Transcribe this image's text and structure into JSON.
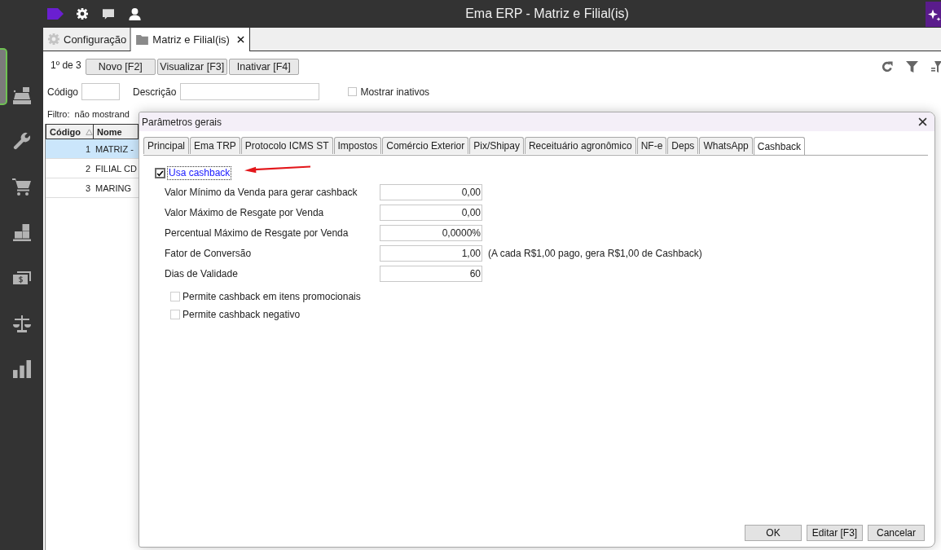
{
  "top_bar": {
    "title": "Ema ERP - Matriz e Filial(is)"
  },
  "tabs": [
    {
      "label": "Configuração",
      "kind": "settings",
      "selected": false,
      "closable": false
    },
    {
      "label": "Matriz e Filial(is)",
      "kind": "folder",
      "selected": true,
      "closable": true
    }
  ],
  "toolbar": {
    "record_counter": "1º de 3",
    "buttons": [
      {
        "label": "Novo [F2]"
      },
      {
        "label": "Visualizar [F3]"
      },
      {
        "label": "Inativar [F4]"
      }
    ]
  },
  "filters": {
    "fields": [
      {
        "label": "Código"
      },
      {
        "label": "Descrição"
      }
    ],
    "show_inactive": {
      "label": "Mostrar inativos",
      "checked": false
    }
  },
  "filter_summary": "Filtro:  não mostrand",
  "table": {
    "columns": [
      {
        "label": "Código",
        "sorted": true
      },
      {
        "label": "Nome",
        "sorted": false
      }
    ],
    "rows": [
      {
        "cells": [
          "1",
          "MATRIZ -"
        ],
        "selected": true
      },
      {
        "cells": [
          "2",
          "FILIAL CD"
        ],
        "selected": false
      },
      {
        "cells": [
          "3",
          "MARING"
        ],
        "selected": false
      }
    ]
  },
  "dialog": {
    "title": "Parâmetros gerais",
    "tabs": [
      {
        "label": "Principal",
        "selected": false
      },
      {
        "label": "Ema TRP",
        "selected": false
      },
      {
        "label": "Protocolo ICMS ST",
        "selected": false
      },
      {
        "label": "Impostos",
        "selected": false
      },
      {
        "label": "Comércio Exterior",
        "selected": false
      },
      {
        "label": "Pix/Shipay",
        "selected": false
      },
      {
        "label": "Receituário agronômico",
        "selected": false
      },
      {
        "label": "NF-e",
        "selected": false
      },
      {
        "label": "Deps",
        "selected": false
      },
      {
        "label": "WhatsApp",
        "selected": false
      },
      {
        "label": "Cashback",
        "selected": true
      }
    ],
    "use_cashback": {
      "label": "Usa cashback",
      "checked": true
    },
    "fields": [
      {
        "label": "Valor Mínimo da Venda para gerar cashback",
        "value": "0,00"
      },
      {
        "label": "Valor Máximo de Resgate por Venda",
        "value": "0,00"
      },
      {
        "label": "Percentual Máximo de Resgate por Venda",
        "value": "0,0000%"
      },
      {
        "label": "Fator de Conversão",
        "value": "1,00",
        "hint": "(A cada R$1,00 pago, gera R$1,00 de Cashback)"
      },
      {
        "label": "Dias de Validade",
        "value": "60"
      }
    ],
    "options": [
      {
        "label": "Permite cashback em itens promocionais",
        "checked": false
      },
      {
        "label": "Permite cashback negativo",
        "checked": false
      }
    ],
    "buttons": [
      {
        "label": "OK"
      },
      {
        "label": "Editar [F3]"
      },
      {
        "label": "Cancelar"
      }
    ]
  }
}
